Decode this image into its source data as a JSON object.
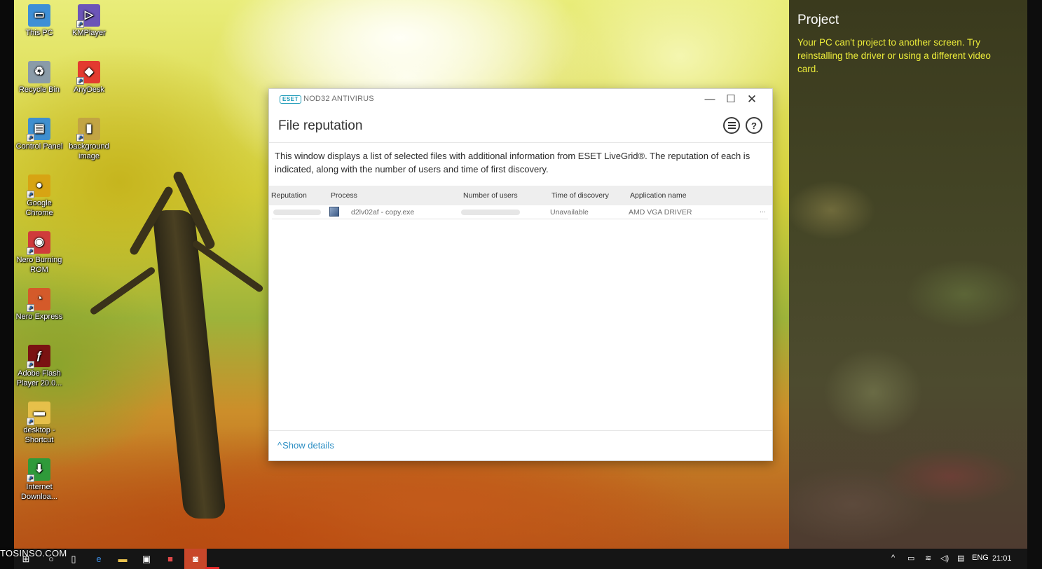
{
  "desktop": {
    "icons": [
      {
        "label": "This PC",
        "icon": "monitor-icon",
        "glyph": "▭",
        "color": "#3e8fd6"
      },
      {
        "label": "KMPlayer",
        "icon": "kmplayer-icon",
        "glyph": "▷",
        "color": "#6c55b8"
      },
      {
        "label": "Recycle Bin",
        "icon": "recycle-bin-icon",
        "glyph": "♻",
        "color": "#8a9ba8"
      },
      {
        "label": "AnyDesk",
        "icon": "anydesk-icon",
        "glyph": "◆",
        "color": "#e33b30"
      },
      {
        "label": "Control Panel",
        "icon": "control-panel-icon",
        "glyph": "▤",
        "color": "#3f8fcf"
      },
      {
        "label": "background image",
        "icon": "image-file-icon",
        "glyph": "▮",
        "color": "#c2a443"
      },
      {
        "label": "Google Chrome",
        "icon": "chrome-icon",
        "glyph": "●",
        "color": "#d7a413"
      },
      {
        "label": "Nero Burning ROM",
        "icon": "nero-burning-icon",
        "glyph": "◉",
        "color": "#cf3b3b"
      },
      {
        "label": "Nero Express",
        "icon": "nero-express-icon",
        "glyph": "◔",
        "color": "#d45a2a"
      },
      {
        "label": "Adobe Flash Player 20.0...",
        "icon": "flash-player-icon",
        "glyph": "ƒ",
        "color": "#7a1212"
      },
      {
        "label": "desktop - Shortcut",
        "icon": "folder-icon",
        "glyph": "▬",
        "color": "#e6c04a"
      },
      {
        "label": "Internet Downloa...",
        "icon": "internet-download-icon",
        "glyph": "⬇",
        "color": "#2f9a3a"
      }
    ]
  },
  "project_panel": {
    "title": "Project",
    "message": "Your PC can't project to another screen. Try reinstalling the driver or using a different video card."
  },
  "window": {
    "badge": "ESET",
    "app_name": "NOD32 ANTIVIRUS",
    "minimize": "—",
    "maximize": "☐",
    "close": "✕",
    "title": "File reputation",
    "help": "?",
    "description": "This window displays a list of selected files with additional information from ESET LiveGrid®. The reputation of each is indicated, along with the number of users and time of first discovery.",
    "columns": {
      "reputation": "Reputation",
      "process": "Process",
      "users": "Number of users",
      "time": "Time of discovery",
      "app": "Application name"
    },
    "rows": [
      {
        "process": "d2lv02af - copy.exe",
        "time": "Unavailable",
        "app": "AMD VGA DRIVER",
        "more": "..."
      }
    ],
    "show_details": "Show details",
    "show_details_chevron": "^"
  },
  "watermark": "TOSINSO.COM",
  "taskbar": {
    "language": "ENG",
    "time": "21:01"
  },
  "colors": {
    "accent": "#2d8fc4",
    "eset_teal": "#1c9ab8",
    "project_text": "#ecec3a"
  }
}
